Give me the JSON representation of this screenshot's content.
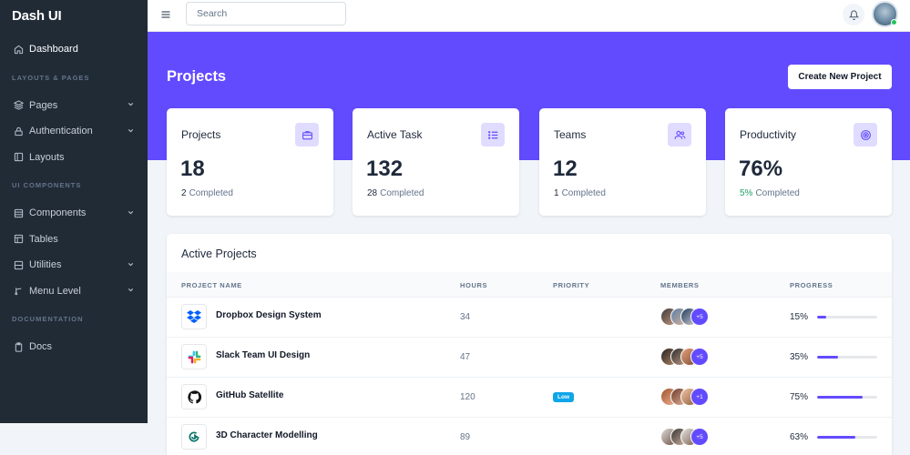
{
  "brand": "Dash UI",
  "sidebar": {
    "items": [
      {
        "type": "item",
        "label": "Dashboard",
        "icon": "home-icon",
        "active": true,
        "chevron": false
      },
      {
        "type": "heading",
        "label": "LAYOUTS & PAGES"
      },
      {
        "type": "item",
        "label": "Pages",
        "icon": "layers-icon",
        "chevron": true
      },
      {
        "type": "item",
        "label": "Authentication",
        "icon": "lock-icon",
        "chevron": true
      },
      {
        "type": "item",
        "label": "Layouts",
        "icon": "sidebar-layout-icon",
        "chevron": false
      },
      {
        "type": "heading",
        "label": "UI COMPONENTS"
      },
      {
        "type": "item",
        "label": "Components",
        "icon": "package-icon",
        "chevron": true
      },
      {
        "type": "item",
        "label": "Tables",
        "icon": "table-icon",
        "chevron": false
      },
      {
        "type": "item",
        "label": "Utilities",
        "icon": "box-icon",
        "chevron": true
      },
      {
        "type": "item",
        "label": "Menu Level",
        "icon": "git-branch-icon",
        "chevron": true
      },
      {
        "type": "heading",
        "label": "DOCUMENTATION"
      },
      {
        "type": "item",
        "label": "Docs",
        "icon": "clipboard-icon",
        "chevron": false
      }
    ]
  },
  "topbar": {
    "search_placeholder": "Search"
  },
  "hero": {
    "title": "Projects",
    "create_button": "Create New Project"
  },
  "stats": [
    {
      "title": "Projects",
      "value": "18",
      "sub_num": "2",
      "sub_label": "Completed",
      "icon": "briefcase-icon",
      "highlight": false
    },
    {
      "title": "Active Task",
      "value": "132",
      "sub_num": "28",
      "sub_label": "Completed",
      "icon": "list-icon",
      "highlight": false
    },
    {
      "title": "Teams",
      "value": "12",
      "sub_num": "1",
      "sub_label": "Completed",
      "icon": "users-icon",
      "highlight": false
    },
    {
      "title": "Productivity",
      "value": "76%",
      "sub_num": "5%",
      "sub_label": "Completed",
      "icon": "target-icon",
      "highlight": true
    }
  ],
  "projects": {
    "title": "Active Projects",
    "columns": [
      "PROJECT NAME",
      "HOURS",
      "PRIORITY",
      "MEMBERS",
      "PROGRESS"
    ],
    "rows": [
      {
        "name": "Dropbox Design System",
        "hours": "34",
        "priority": "",
        "more": "+5",
        "progress_label": "15%",
        "progress": 0.15,
        "logo": "dropbox-logo-icon"
      },
      {
        "name": "Slack Team UI Design",
        "hours": "47",
        "priority": "",
        "more": "+5",
        "progress_label": "35%",
        "progress": 0.35,
        "logo": "slack-logo-icon"
      },
      {
        "name": "GitHub Satellite",
        "hours": "120",
        "priority": "Low",
        "more": "+1",
        "progress_label": "75%",
        "progress": 0.75,
        "logo": "github-logo-icon"
      },
      {
        "name": "3D Character Modelling",
        "hours": "89",
        "priority": "",
        "more": "+5",
        "progress_label": "63%",
        "progress": 0.63,
        "logo": "3d-logo-icon"
      }
    ]
  },
  "colors": {
    "primary": "#624bff",
    "sidebar": "#212b36",
    "success": "#22a06b",
    "info": "#0ea5e9"
  }
}
